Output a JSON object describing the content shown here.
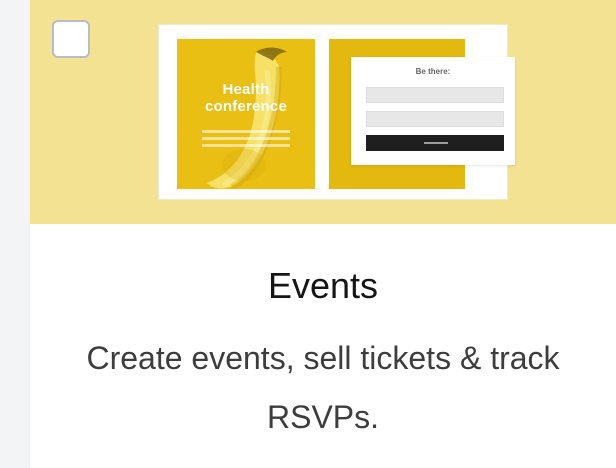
{
  "card": {
    "selected": false,
    "title": "Events",
    "description": "Create events, sell tickets & track RSVPs."
  },
  "preview": {
    "poster": {
      "title": "Health conference"
    },
    "form": {
      "heading": "Be there:"
    }
  },
  "colors": {
    "page_background": "#f3f4f6",
    "hero_background": "#f3e292",
    "poster_yellow": "#e9bf13",
    "form_yellow": "#e3b90f",
    "button_black": "#1f1f1f"
  },
  "icons": {
    "checkbox": "checkbox-unchecked-icon",
    "poster_graphic": "banana-icon"
  }
}
